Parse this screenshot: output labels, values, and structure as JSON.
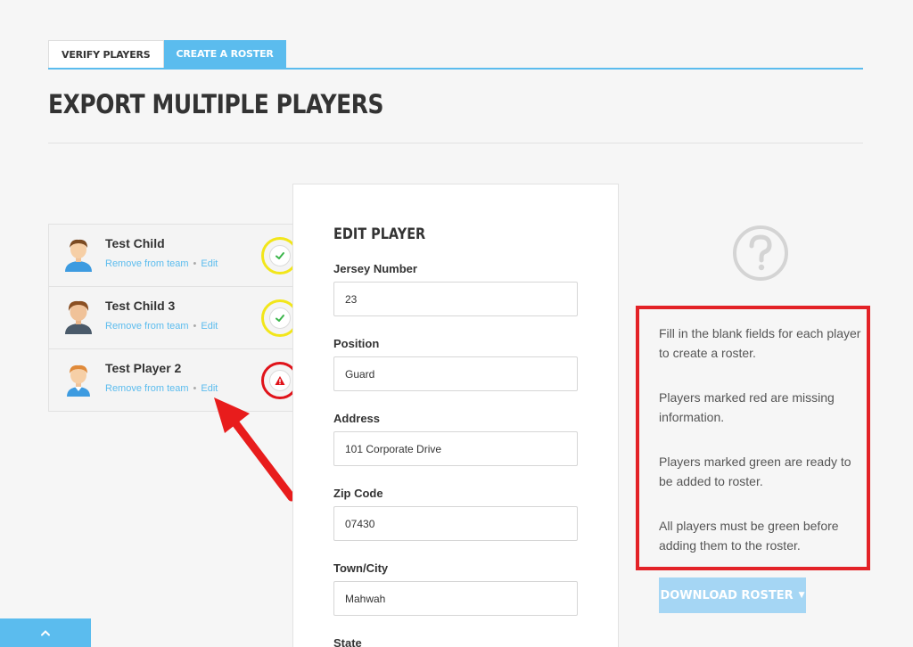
{
  "tabs": [
    {
      "label": "VERIFY PLAYERS",
      "active": false
    },
    {
      "label": "CREATE A ROSTER",
      "active": true
    }
  ],
  "page_title": "EXPORT MULTIPLE PLAYERS",
  "players": [
    {
      "name": "Test Child",
      "remove_label": "Remove from team",
      "edit_label": "Edit",
      "status": "complete",
      "status_icon": "check-icon"
    },
    {
      "name": "Test Child 3",
      "remove_label": "Remove from team",
      "edit_label": "Edit",
      "status": "complete",
      "status_icon": "check-icon"
    },
    {
      "name": "Test Player 2",
      "remove_label": "Remove from team",
      "edit_label": "Edit",
      "status": "missing-info",
      "status_icon": "warning-icon"
    }
  ],
  "edit_player": {
    "title": "EDIT PLAYER",
    "fields": [
      {
        "label": "Jersey Number",
        "value": "23"
      },
      {
        "label": "Position",
        "value": "Guard"
      },
      {
        "label": "Address",
        "value": "101 Corporate Drive"
      },
      {
        "label": "Zip Code",
        "value": "07430"
      },
      {
        "label": "Town/City",
        "value": "Mahwah"
      },
      {
        "label": "State",
        "value": ""
      }
    ]
  },
  "info": {
    "help_icon": "question-circle-icon",
    "paragraphs": [
      "Fill in the blank fields for each player to create a roster.",
      "Players marked red are missing information.",
      "Players marked green are ready to be added to roster.",
      "All players must be green before adding them to the roster."
    ]
  },
  "download_button": {
    "label": "DOWNLOAD ROSTER",
    "icon": "caret-down-icon"
  },
  "bottom_tab": {
    "icon": "chevron-up-icon"
  },
  "colors": {
    "accent": "#5bbcee",
    "success": "#3bb54a",
    "danger": "#e0131a",
    "highlight_ring": "#f2e61a",
    "annotation_red": "#e32227"
  }
}
